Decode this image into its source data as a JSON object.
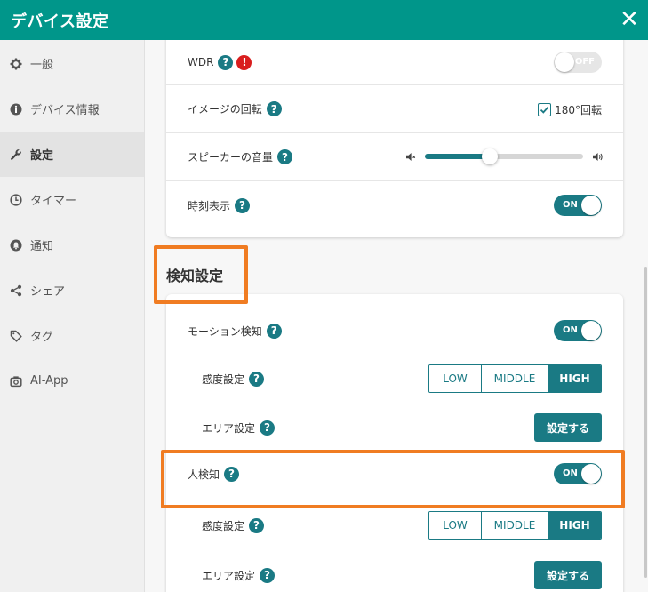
{
  "window": {
    "title": "デバイス設定",
    "close_icon": "close-icon"
  },
  "sidebar": {
    "items": [
      {
        "label": "一般",
        "icon": "gear-icon"
      },
      {
        "label": "デバイス情報",
        "icon": "info-icon"
      },
      {
        "label": "設定",
        "icon": "wrench-icon"
      },
      {
        "label": "タイマー",
        "icon": "clock-icon"
      },
      {
        "label": "通知",
        "icon": "bell-icon"
      },
      {
        "label": "シェア",
        "icon": "share-icon"
      },
      {
        "label": "タグ",
        "icon": "tag-icon"
      },
      {
        "label": "AI-App",
        "icon": "camera-icon"
      }
    ],
    "active_index": 2
  },
  "camera_settings": {
    "wdr": {
      "label": "WDR",
      "toggle": "OFF"
    },
    "rotation": {
      "label": "イメージの回転",
      "checkbox_label": "180°回転",
      "checked": true
    },
    "speaker": {
      "label": "スピーカーの音量",
      "volume_fraction": 0.41
    },
    "time_display": {
      "label": "時刻表示",
      "toggle": "ON"
    }
  },
  "detection": {
    "section_title": "検知設定",
    "motion": {
      "label": "モーション検知",
      "toggle": "ON"
    },
    "motion_sensitivity": {
      "label": "感度設定",
      "options": [
        "LOW",
        "MIDDLE",
        "HIGH"
      ],
      "selected": "HIGH"
    },
    "motion_area": {
      "label": "エリア設定",
      "button": "設定する"
    },
    "human": {
      "label": "人検知",
      "toggle": "ON"
    },
    "human_sensitivity": {
      "label": "感度設定",
      "options": [
        "LOW",
        "MIDDLE",
        "HIGH"
      ],
      "selected": "HIGH"
    },
    "human_area": {
      "label": "エリア設定",
      "button": "設定する"
    }
  },
  "colors": {
    "header": "#00968a",
    "accent": "#1a7a84",
    "highlight": "#f07c22",
    "warning": "#d91e1e"
  }
}
